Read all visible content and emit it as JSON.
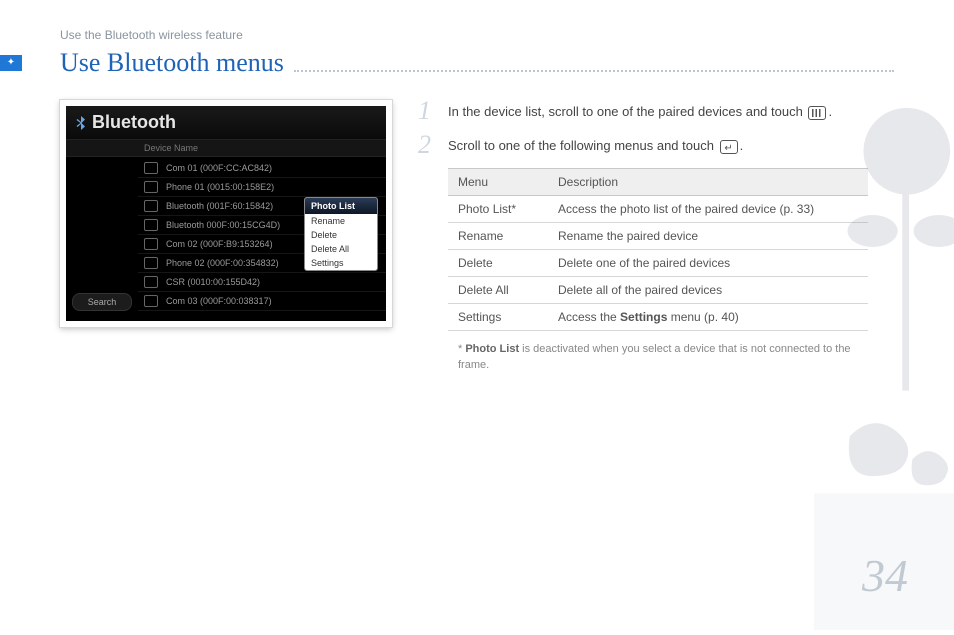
{
  "breadcrumb": "Use the Bluetooth wireless feature",
  "title": "Use Bluetooth menus",
  "screenshot": {
    "window_title": "Bluetooth",
    "column_header": "Device Name",
    "search_label": "Search",
    "devices": [
      "Com 01 (000F:CC:AC842)",
      "Phone 01 (0015:00:158E2)",
      "Bluetooth (001F:60:15842)",
      "Bluetooth 000F:00:15CG4D)",
      "Com 02 (000F:B9:153264)",
      "Phone 02 (000F:00:354832)",
      "CSR (0010:00:155D42)",
      "Com 03 (000F:00:038317)"
    ],
    "popup": {
      "header": "Photo List",
      "items": [
        "Rename",
        "Delete",
        "Delete All",
        "Settings"
      ]
    }
  },
  "steps": [
    {
      "num": "1",
      "pre": "In the device list, scroll to one of the paired devices and touch ",
      "icon": "bars",
      "post": "."
    },
    {
      "num": "2",
      "pre": "Scroll to one of the following menus and touch ",
      "icon": "enter",
      "post": "."
    }
  ],
  "table": {
    "headers": [
      "Menu",
      "Description"
    ],
    "rows": [
      {
        "menu": "Photo List*",
        "desc_pre": "Access the photo list of the paired device (p. 33)",
        "bold": "",
        "desc_post": ""
      },
      {
        "menu": "Rename",
        "desc_pre": "Rename the paired device",
        "bold": "",
        "desc_post": ""
      },
      {
        "menu": "Delete",
        "desc_pre": "Delete one of the paired devices",
        "bold": "",
        "desc_post": ""
      },
      {
        "menu": "Delete All",
        "desc_pre": "Delete all of the paired devices",
        "bold": "",
        "desc_post": ""
      },
      {
        "menu": "Settings",
        "desc_pre": "Access the ",
        "bold": "Settings",
        "desc_post": " menu (p. 40)"
      }
    ]
  },
  "footnote": {
    "star": "*",
    "bold": "Photo List",
    "rest": " is deactivated when you select a device that is not connected to the frame."
  },
  "page_number": "34"
}
